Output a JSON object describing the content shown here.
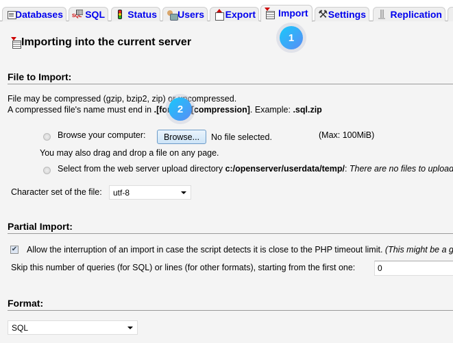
{
  "tabs": [
    {
      "label": "Databases",
      "icon": "databases-icon",
      "active": false
    },
    {
      "label": "SQL",
      "icon": "sql-icon",
      "active": false
    },
    {
      "label": "Status",
      "icon": "status-icon",
      "active": false
    },
    {
      "label": "Users",
      "icon": "users-icon",
      "active": false
    },
    {
      "label": "Export",
      "icon": "export-icon",
      "active": false
    },
    {
      "label": "Import",
      "icon": "import-icon",
      "active": true
    },
    {
      "label": "Settings",
      "icon": "settings-icon",
      "active": false
    },
    {
      "label": "Replication",
      "icon": "replication-icon",
      "active": false
    }
  ],
  "markers": [
    "1",
    "2"
  ],
  "page_title": "Importing into the current server",
  "file_to_import": {
    "heading": "File to Import:",
    "line1": "File may be compressed (gzip, bzip2, zip) or uncompressed.",
    "line2_prefix": "A compressed file's name must end in ",
    "line2_bold": ".[format].[compression]",
    "line2_mid": ". Example: ",
    "line2_example": ".sql.zip",
    "browse_label": "Browse your computer:",
    "browse_button": "Browse...",
    "no_file": "No file selected.",
    "max_size": "(Max: 100MiB)",
    "drag_drop": "You may also drag and drop a file on any page.",
    "server_dir_label": "Select from the web server upload directory ",
    "server_dir_path": "c:/openserver/userdata/temp/",
    "server_dir_colon": ": ",
    "server_dir_note": "There are no files to upload",
    "charset_label": "Character set of the file:",
    "charset_value": "utf-8"
  },
  "partial_import": {
    "heading": "Partial Import:",
    "allow_interrupt_checked": true,
    "allow_interrupt_label": "Allow the interruption of an import in case the script detects it is close to the PHP timeout limit. ",
    "allow_interrupt_note": "(This might be a good way to import large files, however it can break transactions.)",
    "skip_label": "Skip this number of queries (for SQL) or lines (for other formats), starting from the first one:",
    "skip_value": "0"
  },
  "format": {
    "heading": "Format:",
    "value": "SQL"
  }
}
